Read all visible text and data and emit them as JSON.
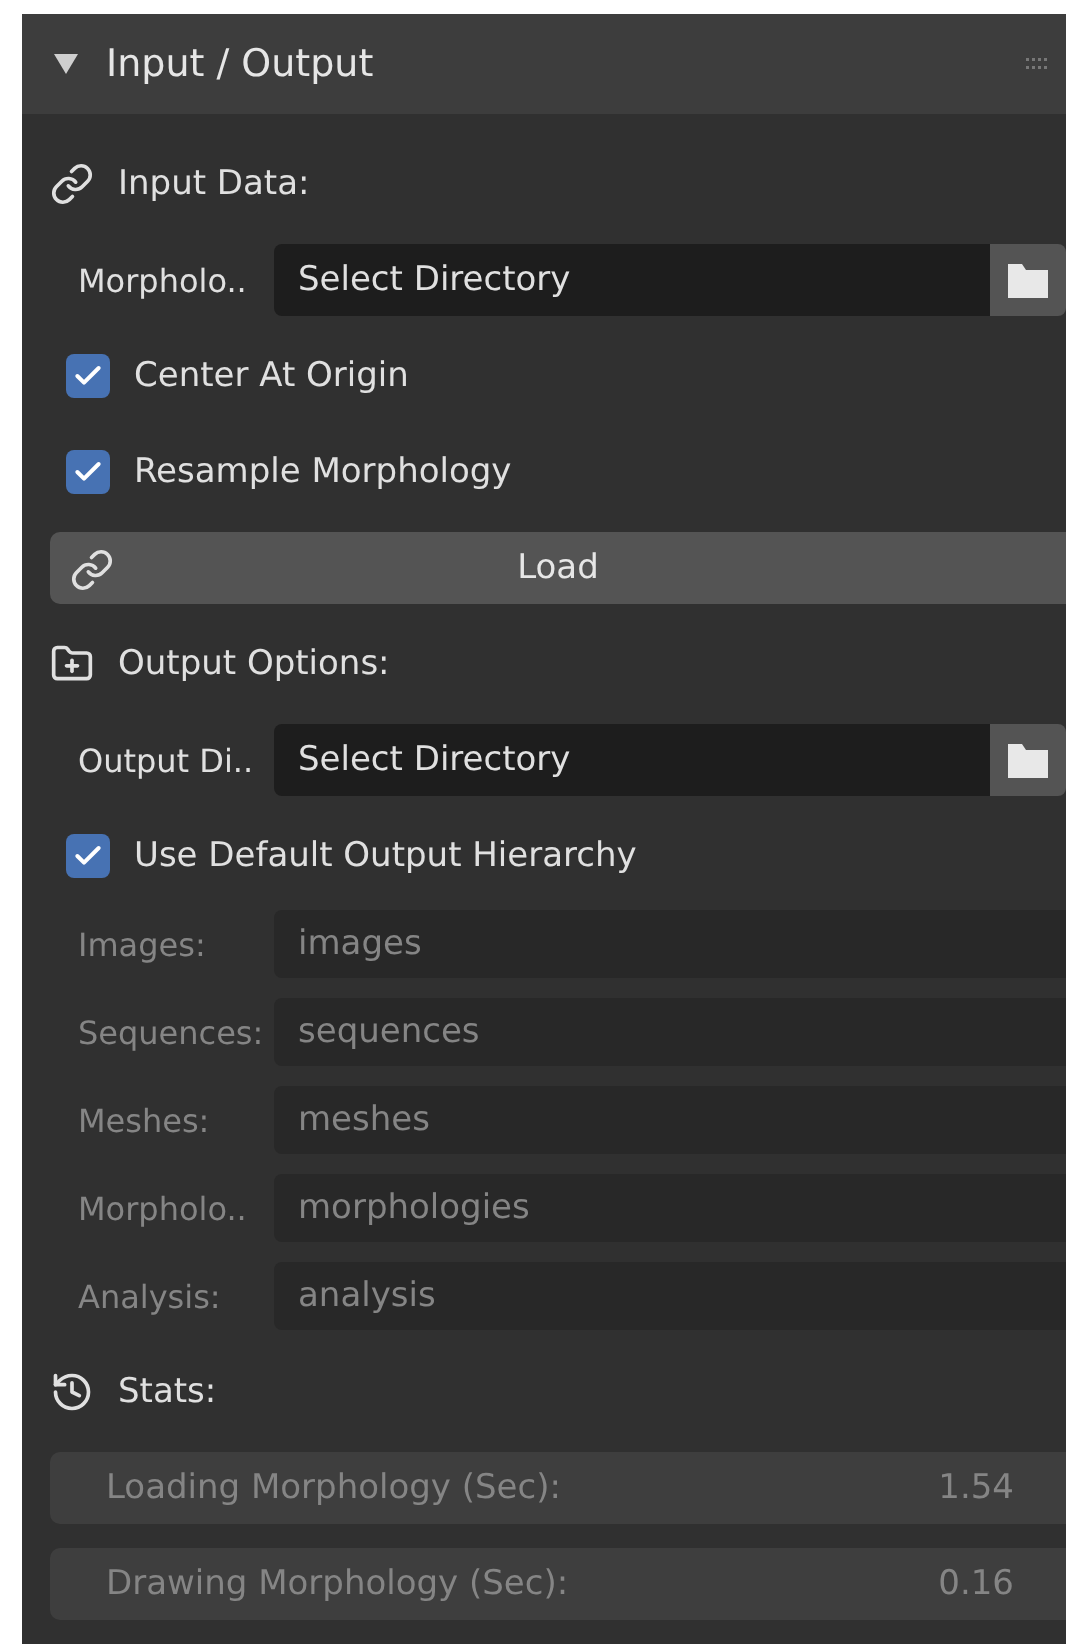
{
  "panel": {
    "title": "Input / Output",
    "expanded": true
  },
  "rows": [
    {
      "kind": "heading",
      "label": "Input Data:"
    },
    {
      "kind": "path",
      "label": "Morpholo..",
      "value": "Select Directory"
    },
    {
      "kind": "checkbox",
      "label": "Center At Origin",
      "checked": true
    },
    {
      "kind": "checkbox",
      "label": "Resample Morphology",
      "checked": true
    },
    {
      "kind": "button",
      "label": "Load"
    },
    {
      "kind": "heading",
      "label": "Output Options:"
    },
    {
      "kind": "path",
      "label": "Output Di..",
      "value": "Select Directory"
    },
    {
      "kind": "checkbox",
      "label": "Use Default Output Hierarchy",
      "checked": true
    },
    {
      "kind": "field",
      "label": "Images:",
      "value": "images",
      "disabled": true
    },
    {
      "kind": "field",
      "label": "Sequences:",
      "value": "sequences",
      "disabled": true
    },
    {
      "kind": "field",
      "label": "Meshes:",
      "value": "meshes",
      "disabled": true
    },
    {
      "kind": "field",
      "label": "Morpholo..",
      "value": "morphologies",
      "disabled": true
    },
    {
      "kind": "field",
      "label": "Analysis:",
      "value": "analysis",
      "disabled": true
    },
    {
      "kind": "heading",
      "label": "Stats:"
    },
    {
      "kind": "stat",
      "label": "Loading Morphology (Sec):",
      "value": "1.54"
    },
    {
      "kind": "stat",
      "label": "Drawing Morphology (Sec):",
      "value": "0.16"
    }
  ]
}
